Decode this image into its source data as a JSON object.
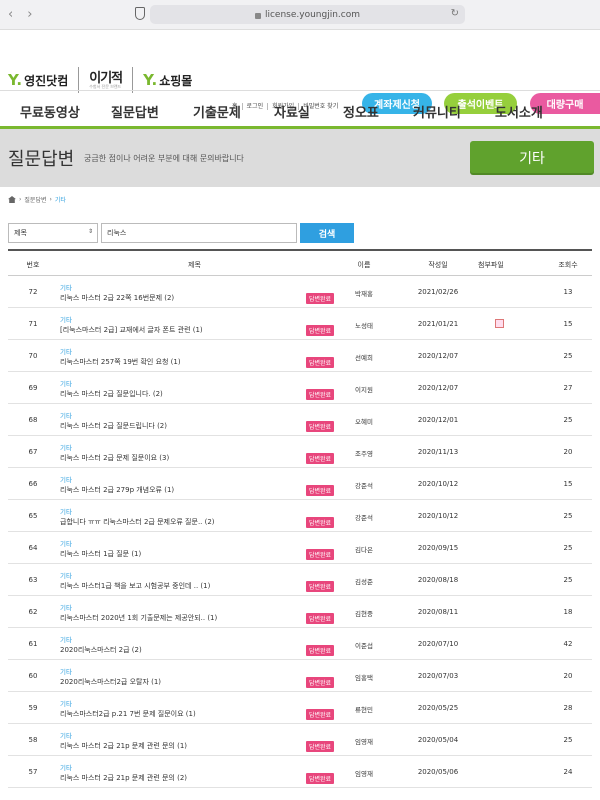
{
  "browser": {
    "url": "license.youngjin.com"
  },
  "logos": {
    "youngjin": "영진닷컴",
    "ijc": "이기적",
    "ijc_sub": "수험서 전문 브랜드",
    "shop": "쇼핑몰"
  },
  "toplinks": [
    "홈",
    "로그인",
    "회원가입",
    "비밀번호 찾기"
  ],
  "pills": {
    "blue": "계좌제신청",
    "green": "출석이벤트",
    "pink": "대량구매"
  },
  "nav": [
    "무료동영상",
    "질문답변",
    "기출문제",
    "자료실",
    "정오표",
    "커뮤니티",
    "도서소개"
  ],
  "banner": {
    "title": "질문답변",
    "desc": "궁금한 점이나 어려운 부분에 대해 문의바랍니다",
    "category": "기타"
  },
  "breadcrumb": [
    "질문답변",
    "기타"
  ],
  "search": {
    "select": "제목",
    "query": "리눅스",
    "button": "검색"
  },
  "columns": {
    "num": "번호",
    "title": "제목",
    "name": "이름",
    "date": "작성일",
    "file": "첨부파일",
    "views": "조회수"
  },
  "badge_label": "답변완료",
  "rows": [
    {
      "num": "72",
      "cat": "기타",
      "subject": "리눅스 마스터 2급 22쪽 16번문제 (2)",
      "name": "박재홍",
      "date": "2021/02/26",
      "views": "13",
      "file": false
    },
    {
      "num": "71",
      "cat": "기타",
      "subject": "[리눅스마스터 2급] 교재에서 글자 폰트 관련 (1)",
      "name": "노성태",
      "date": "2021/01/21",
      "views": "15",
      "file": true
    },
    {
      "num": "70",
      "cat": "기타",
      "subject": "리눅스마스터 257쪽 19번 확인 요청 (1)",
      "name": "선예희",
      "date": "2020/12/07",
      "views": "25",
      "file": false
    },
    {
      "num": "69",
      "cat": "기타",
      "subject": "리눅스 마스터 2급 질문입니다. (2)",
      "name": "이지원",
      "date": "2020/12/07",
      "views": "27",
      "file": false
    },
    {
      "num": "68",
      "cat": "기타",
      "subject": "리눅스 마스터 2급 질문드립니다 (2)",
      "name": "오혜미",
      "date": "2020/12/01",
      "views": "25",
      "file": false
    },
    {
      "num": "67",
      "cat": "기타",
      "subject": "리눅스 마스터 2급 문제 질문이요 (3)",
      "name": "조주영",
      "date": "2020/11/13",
      "views": "20",
      "file": false
    },
    {
      "num": "66",
      "cat": "기타",
      "subject": "리눅스 마스터 2급 279p 개념오류 (1)",
      "name": "강준석",
      "date": "2020/10/12",
      "views": "15",
      "file": false
    },
    {
      "num": "65",
      "cat": "기타",
      "subject": "급합니다 ㅠㅠ 리눅스마스터 2급 문제오류 질문.. (2)",
      "name": "강준석",
      "date": "2020/10/12",
      "views": "25",
      "file": false
    },
    {
      "num": "64",
      "cat": "기타",
      "subject": "리눅스 마스터 1급 질문 (1)",
      "name": "김다은",
      "date": "2020/09/15",
      "views": "25",
      "file": false
    },
    {
      "num": "63",
      "cat": "기타",
      "subject": "리눅스 마스터1급 책을 보고 시험공부 중인데 .. (1)",
      "name": "김성준",
      "date": "2020/08/18",
      "views": "25",
      "file": false
    },
    {
      "num": "62",
      "cat": "기타",
      "subject": "리눅스마스터 2020년 1회 기출문제는 제공안되.. (1)",
      "name": "김현중",
      "date": "2020/08/11",
      "views": "18",
      "file": false
    },
    {
      "num": "61",
      "cat": "기타",
      "subject": "2020리눅스마스터 2급 (2)",
      "name": "이준섭",
      "date": "2020/07/10",
      "views": "42",
      "file": false
    },
    {
      "num": "60",
      "cat": "기타",
      "subject": "2020리눅스마스터2급 오탈자 (1)",
      "name": "임홍택",
      "date": "2020/07/03",
      "views": "20",
      "file": false
    },
    {
      "num": "59",
      "cat": "기타",
      "subject": "리눅스마스터2급 p.21 7번 문제 질문이요 (1)",
      "name": "류현민",
      "date": "2020/05/25",
      "views": "28",
      "file": false
    },
    {
      "num": "58",
      "cat": "기타",
      "subject": "리눅스 마스터 2급 21p 문제 관련 문의 (1)",
      "name": "임영재",
      "date": "2020/05/04",
      "views": "25",
      "file": false
    },
    {
      "num": "57",
      "cat": "기타",
      "subject": "리눅스 마스터 2급 21p 문제 관련 문의 (2)",
      "name": "임영재",
      "date": "2020/05/06",
      "views": "24",
      "file": false
    }
  ]
}
